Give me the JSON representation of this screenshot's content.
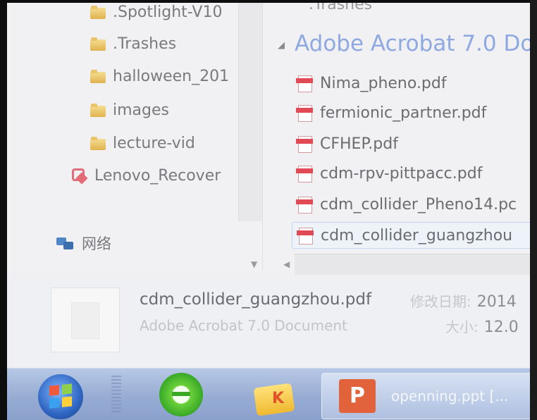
{
  "nav_pane": {
    "items": [
      {
        "label": ".Spotlight-V10",
        "icon": "folder-icon"
      },
      {
        "label": ".Trashes",
        "icon": "folder-icon"
      },
      {
        "label": "halloween_201",
        "icon": "folder-icon"
      },
      {
        "label": "images",
        "icon": "folder-icon"
      },
      {
        "label": "lecture-vid",
        "icon": "folder-icon"
      },
      {
        "label": "Lenovo_Recover",
        "icon": "recovery-drive-icon"
      }
    ],
    "network_label": "网络"
  },
  "file_list": {
    "top_partial": ".Trashes",
    "group_header": "Adobe Acrobat 7.0 Do",
    "files": [
      {
        "name": "Nima_pheno.pdf"
      },
      {
        "name": "fermionic_partner.pdf"
      },
      {
        "name": "CFHEP.pdf"
      },
      {
        "name": "cdm-rpv-pittpacc.pdf"
      },
      {
        "name": "cdm_collider_Pheno14.pc"
      },
      {
        "name": "cdm_collider_guangzhou",
        "selected": true
      }
    ]
  },
  "details_pane": {
    "file_name": "cdm_collider_guangzhou.pdf",
    "file_type": "Adobe Acrobat 7.0 Document",
    "modified_label": "修改日期:",
    "modified_value": "2014",
    "size_label": "大小:",
    "size_value": "12.0"
  },
  "taskbar": {
    "start_icon": "windows-start-orb",
    "pinned": [
      "internet-explorer-icon",
      "file-explorer-icon"
    ],
    "active_window_label": "openning.ppt [..."
  },
  "colors": {
    "group_header": "#8ea8e2",
    "selection_border": "#c4d6ee",
    "taskbar": "#97acd3"
  }
}
